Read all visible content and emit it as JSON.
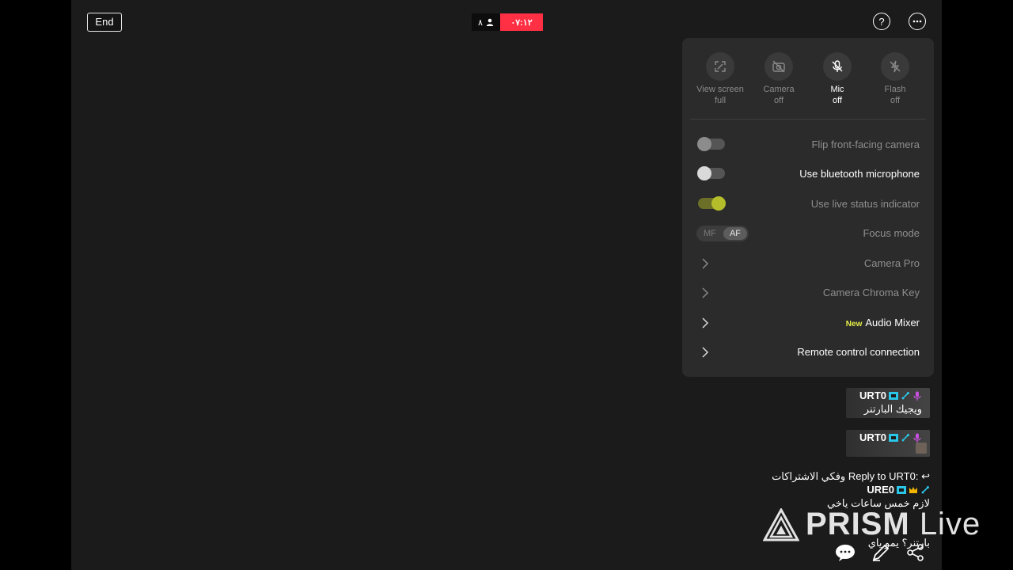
{
  "top": {
    "end_label": "End",
    "viewer_count": "٨",
    "timer": "٠٧:١٢",
    "help_icon": "help-icon",
    "more_icon": "more-icon"
  },
  "panel": {
    "quick_actions": [
      {
        "line1": "View screen",
        "line2": "full",
        "icon": "fullscreen-icon"
      },
      {
        "line1": "Camera",
        "line2": "off",
        "icon": "camera-off-icon"
      },
      {
        "line1": "Mic",
        "line2": "off",
        "icon": "mic-off-icon"
      },
      {
        "line1": "Flash",
        "line2": "off",
        "icon": "flash-off-icon"
      }
    ],
    "settings": {
      "flip_camera": "Flip front-facing camera",
      "bluetooth_mic": "Use bluetooth microphone",
      "live_indicator": "Use live status indicator",
      "focus_mode": "Focus mode",
      "focus_mf": "MF",
      "focus_af": "AF",
      "camera_pro": "Camera Pro",
      "chroma_key": "Camera Chroma Key",
      "new_badge": "New",
      "audio_mixer": "Audio Mixer",
      "remote_control": "Remote control connection"
    },
    "toggle_states": {
      "flip_camera": false,
      "bluetooth_mic": false,
      "live_indicator": true
    }
  },
  "chat": {
    "msg1_user": "URT0",
    "msg1_text": "ويجيك البارتنر",
    "msg2_user": "URT0",
    "reply_prefix": "Reply to URT0:",
    "reply_text": "وفكي الاشتراكات",
    "msg3_user": "URE0",
    "msg3_text": "لازم خمس ساعات ياخي",
    "msg4_partial": "بارتنر؟ يمو ياي"
  },
  "watermark": {
    "brand": "PRISM",
    "suffix": "Live"
  },
  "colors": {
    "live_red": "#ff2f44",
    "toggle_on": "#b5be2a",
    "new_badge": "#e6f048",
    "mic_purple": "#c84fe0",
    "badge_cyan": "#29c6e8",
    "crown_gold": "#f2b500"
  }
}
